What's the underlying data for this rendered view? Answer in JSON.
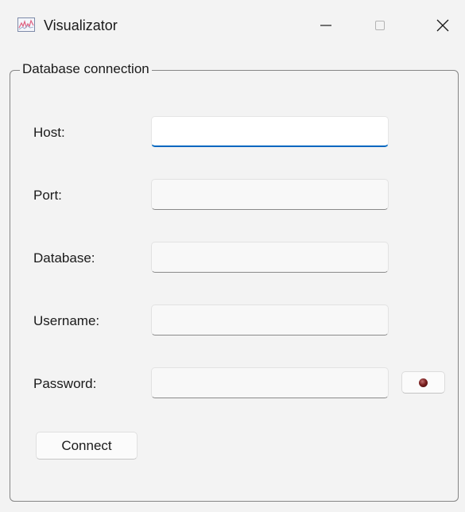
{
  "window": {
    "title": "Visualizator",
    "icon": "chart-icon",
    "controls": {
      "minimize": "minimize-icon",
      "maximize": "maximize-icon",
      "close": "close-icon"
    }
  },
  "group": {
    "title": "Database connection"
  },
  "fields": {
    "host": {
      "label": "Host:",
      "value": ""
    },
    "port": {
      "label": "Port:",
      "value": ""
    },
    "database": {
      "label": "Database:",
      "value": ""
    },
    "username": {
      "label": "Username:",
      "value": ""
    },
    "password": {
      "label": "Password:",
      "value": ""
    }
  },
  "password_toggle_icon": "eye-icon",
  "connect_label": "Connect",
  "colors": {
    "window_bg": "#f3f3f3",
    "focus_accent": "#0067c0",
    "group_border": "#858585"
  }
}
